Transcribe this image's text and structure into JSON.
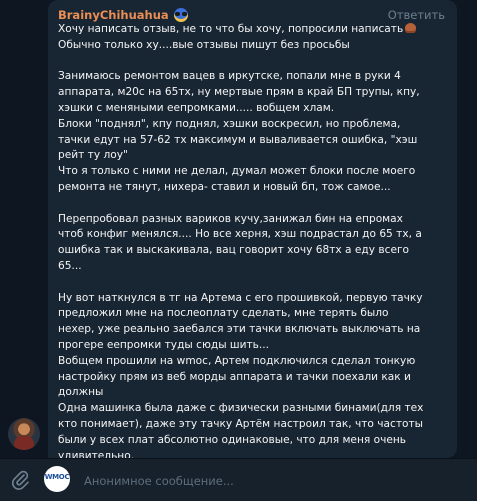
{
  "message": {
    "author": "BrainyChihuahua",
    "author_emoji": "sunglasses-emoji",
    "reply_label": "Ответить",
    "lines": [
      "Хочу написать отзыв, не то что бы хочу, попросили написать",
      "Обычно только ху....вые отзывы пишут без просьбы",
      "",
      "Занимаюсь ремонтом вацев в иркутске, попали мне в руки 4",
      "аппарата, м20с на 65тх, ну мертвые прям в край БП трупы, кпу,",
      "хэшки с меняными еепромками..... вобщем хлам.",
      "Блоки \"поднял\", кпу поднял, хэшки воскресил, но проблема,",
      "тачки едут на 57-62 тх максимум и вываливается ошибка, \"хэш",
      "рейт ту лоу\"",
      "Что я только с ними не делал, думал может блоки после моего",
      "ремонта не тянут, нихера- ставил и новый бп, тож самое...",
      "",
      "Перепробовал разных вариков кучу,занижал бин на епромах",
      "чтоб конфиг менялся.... Но все херня, хэш подрастал до 65 тх, а",
      "ошибка так и выскакивала, вац говорит хочу 68тх а еду всего",
      "65...",
      "",
      "Ну вот наткнулся в тг на Артема с его прошивкой, первую тачку",
      "предложил мне на послеоплату сделать, мне терять было",
      "нехер, уже реально заебался эти тачки включать выключать на",
      "прогере еепромки туды сюды шить...",
      "Вобщем прошили на wmoc, Артем подключился сделал тонкую",
      "настройку прям из веб морды аппарата и тачки поехали как и",
      "должны",
      "Одна машинка была даже с физически разными бинами(для тех",
      "кто понимает), даже эту тачку Артём настроил так, что частоты",
      "были у всех плат абсолютно одинаковые, что для меня очень",
      "удивительно."
    ]
  },
  "composer": {
    "placeholder": "Анонимное сообщение...",
    "channel_avatar_text": "WMOC"
  },
  "colors": {
    "background": "#0e1621",
    "bubble": "#182533",
    "author": "#ea8e54",
    "reply": "#6d7f8f",
    "text": "#f5f5f5",
    "composer": "#17212b"
  }
}
